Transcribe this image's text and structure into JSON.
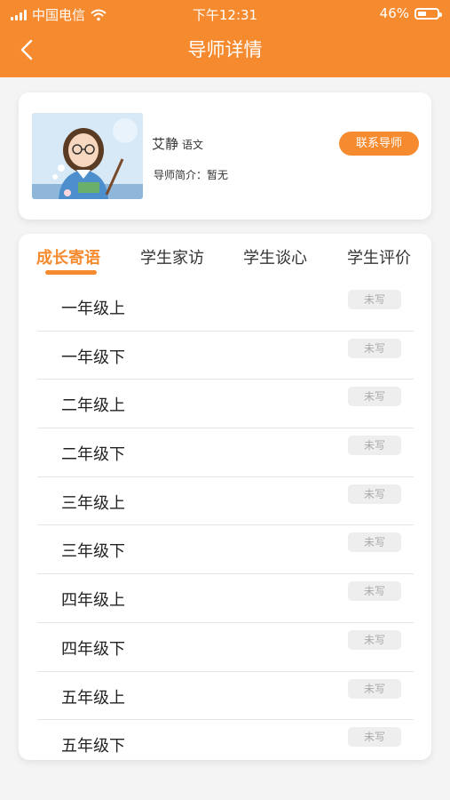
{
  "status_bar": {
    "carrier": "中国电信",
    "time": "下午12:31",
    "battery": "46%",
    "battery_level": 0.46
  },
  "header": {
    "title": "导师详情"
  },
  "profile": {
    "name": "艾静",
    "subject": "语文",
    "bio": "导师简介：暂无",
    "contact_button": "联系导师"
  },
  "tabs": [
    {
      "label": "成长寄语",
      "active": true
    },
    {
      "label": "学生家访",
      "active": false
    },
    {
      "label": "学生谈心",
      "active": false
    },
    {
      "label": "学生评价",
      "active": false
    }
  ],
  "list": [
    {
      "label": "一年级上",
      "status": "未写"
    },
    {
      "label": "一年级下",
      "status": "未写"
    },
    {
      "label": "二年级上",
      "status": "未写"
    },
    {
      "label": "二年级下",
      "status": "未写"
    },
    {
      "label": "三年级上",
      "status": "未写"
    },
    {
      "label": "三年级下",
      "status": "未写"
    },
    {
      "label": "四年级上",
      "status": "未写"
    },
    {
      "label": "四年级下",
      "status": "未写"
    },
    {
      "label": "五年级上",
      "status": "未写"
    },
    {
      "label": "五年级下",
      "status": "未写"
    }
  ],
  "colors": {
    "accent": "#f68a2e",
    "background": "#f4f4f4",
    "badge_bg": "#eeeeee"
  },
  "icons": [
    "signal-icon",
    "wifi-icon",
    "battery-icon",
    "back-arrow-icon"
  ]
}
